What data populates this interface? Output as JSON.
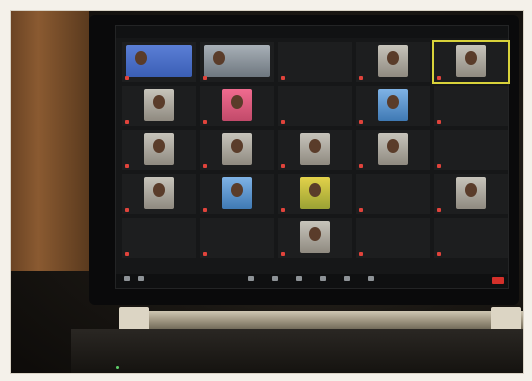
{
  "scene": {
    "description_colors": {
      "wall": "#8a5a31",
      "screen": "#161718",
      "accent_active": "#d8d23a",
      "end_button": "#d4302a"
    }
  },
  "meeting": {
    "tiles": [
      {
        "name": "",
        "variant": "wide"
      },
      {
        "name": "",
        "variant": "wide2"
      },
      {
        "name": "",
        "variant": "none"
      },
      {
        "name": "",
        "variant": "face"
      },
      {
        "name": "",
        "variant": "face",
        "active": true
      },
      {
        "name": "",
        "variant": "face"
      },
      {
        "name": "",
        "variant": "pink"
      },
      {
        "name": "",
        "variant": "none"
      },
      {
        "name": "",
        "variant": "blue"
      },
      {
        "name": "",
        "variant": "none"
      },
      {
        "name": "",
        "variant": "face"
      },
      {
        "name": "",
        "variant": "face"
      },
      {
        "name": "",
        "variant": "face"
      },
      {
        "name": "",
        "variant": "face"
      },
      {
        "name": "",
        "variant": "none"
      },
      {
        "name": "",
        "variant": "face"
      },
      {
        "name": "",
        "variant": "blue"
      },
      {
        "name": "",
        "variant": "yellow"
      },
      {
        "name": "",
        "variant": "none"
      },
      {
        "name": "",
        "variant": "face"
      },
      {
        "name": "",
        "variant": "none"
      },
      {
        "name": "",
        "variant": "none"
      },
      {
        "name": "",
        "variant": "face"
      },
      {
        "name": "",
        "variant": "none"
      },
      {
        "name": "",
        "variant": "none"
      }
    ],
    "toolbar_icons": [
      "mic-icon",
      "video-icon",
      "security-icon",
      "participants-icon",
      "chat-icon",
      "share-screen-icon",
      "record-icon",
      "reactions-icon"
    ]
  }
}
